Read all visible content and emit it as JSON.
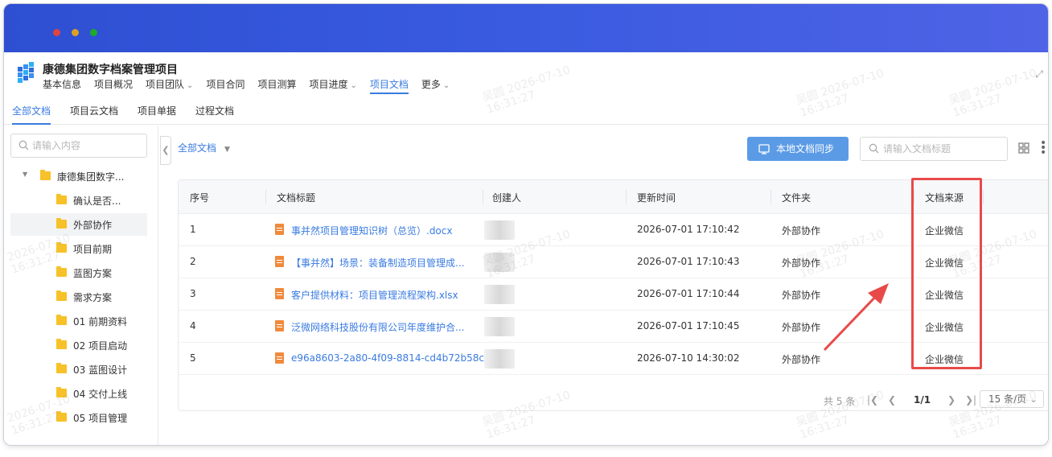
{
  "project": {
    "title": "康德集团数字档案管理项目"
  },
  "topnav": [
    {
      "label": "基本信息",
      "caret": false,
      "active": false
    },
    {
      "label": "项目概况",
      "caret": false,
      "active": false
    },
    {
      "label": "项目团队",
      "caret": true,
      "active": false
    },
    {
      "label": "项目合同",
      "caret": false,
      "active": false
    },
    {
      "label": "项目测算",
      "caret": false,
      "active": false
    },
    {
      "label": "项目进度",
      "caret": true,
      "active": false
    },
    {
      "label": "项目文档",
      "caret": false,
      "active": true
    },
    {
      "label": "更多",
      "caret": true,
      "active": false
    }
  ],
  "subtabs": [
    {
      "label": "全部文档",
      "active": true
    },
    {
      "label": "项目云文档",
      "active": false
    },
    {
      "label": "项目单据",
      "active": false
    },
    {
      "label": "过程文档",
      "active": false
    }
  ],
  "sidebar": {
    "search_placeholder": "请输入内容",
    "root": "康德集团数字...",
    "items": [
      {
        "label": "确认是否..."
      },
      {
        "label": "外部协作"
      },
      {
        "label": "项目前期"
      },
      {
        "label": "蓝图方案"
      },
      {
        "label": "需求方案"
      },
      {
        "label": "01 前期资料"
      },
      {
        "label": "02 项目启动"
      },
      {
        "label": "03 蓝图设计"
      },
      {
        "label": "04 交付上线"
      },
      {
        "label": "05 项目管理"
      }
    ]
  },
  "toolbar": {
    "filter_label": "全部文档",
    "sync_button": "本地文档同步",
    "search_placeholder": "请输入文档标题"
  },
  "table": {
    "headers": [
      "序号",
      "文档标题",
      "创建人",
      "更新时间",
      "文件夹",
      "文档来源"
    ],
    "rows": [
      {
        "no": "1",
        "title": "事并然项目管理知识树（总览）.docx",
        "updated": "2026-07-01 17:10:42",
        "folder": "外部协作",
        "source": "企业微信"
      },
      {
        "no": "2",
        "title": "【事并然】场景：装备制造项目管理成...",
        "updated": "2026-07-01 17:10:43",
        "folder": "外部协作",
        "source": "企业微信"
      },
      {
        "no": "3",
        "title": "客户提供材料：项目管理流程架构.xlsx",
        "updated": "2026-07-01 17:10:44",
        "folder": "外部协作",
        "source": "企业微信"
      },
      {
        "no": "4",
        "title": "泛微网络科技股份有限公司年度维护合...",
        "updated": "2026-07-01 17:10:45",
        "folder": "外部协作",
        "source": "企业微信"
      },
      {
        "no": "5",
        "title": "e96a8603-2a80-4f09-8814-cd4b72b58c...",
        "updated": "2026-07-10 14:30:02",
        "folder": "外部协作",
        "source": "企业微信"
      }
    ]
  },
  "pager": {
    "total": "共 5 条",
    "page": "1/1",
    "page_size": "15 条/页"
  },
  "watermark": {
    "name": "吴圆",
    "date": "2026-07-10",
    "time": "16:31:27"
  },
  "colors": {
    "titlebar_start": "#2e4fd2",
    "titlebar_end": "#4f63e6",
    "accent": "#3a7be0",
    "sync_button": "#5b9be6",
    "annotation": "#e84a4a",
    "folder": "#f7c129",
    "file": "#f08a3c"
  },
  "icons": [
    "logo-icon",
    "expand-icon",
    "search-icon",
    "folder-icon",
    "file-icon",
    "sync-icon",
    "grid-view-icon",
    "more-icon",
    "chevron-left-icon",
    "chevron-right-icon",
    "caret-down-icon"
  ]
}
